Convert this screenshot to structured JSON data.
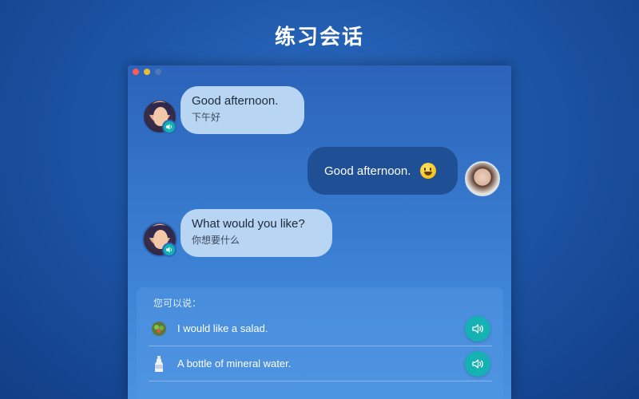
{
  "headline": "练习会话",
  "messages": [
    {
      "main": "Good afternoon.",
      "sub": "下午好"
    },
    {
      "main": "Good afternoon."
    },
    {
      "main": "What would you like?",
      "sub": "你想要什么"
    }
  ],
  "suggestions": {
    "title": "您可以说：",
    "options": [
      {
        "text": "I would like a salad.",
        "icon": "salad-icon"
      },
      {
        "text": "A bottle of mineral water.",
        "icon": "bottle-icon"
      }
    ]
  },
  "colors": {
    "accent": "#16b1b3",
    "incoming_bubble": "#b8d5f4",
    "outgoing_bubble": "#1f4f95"
  }
}
